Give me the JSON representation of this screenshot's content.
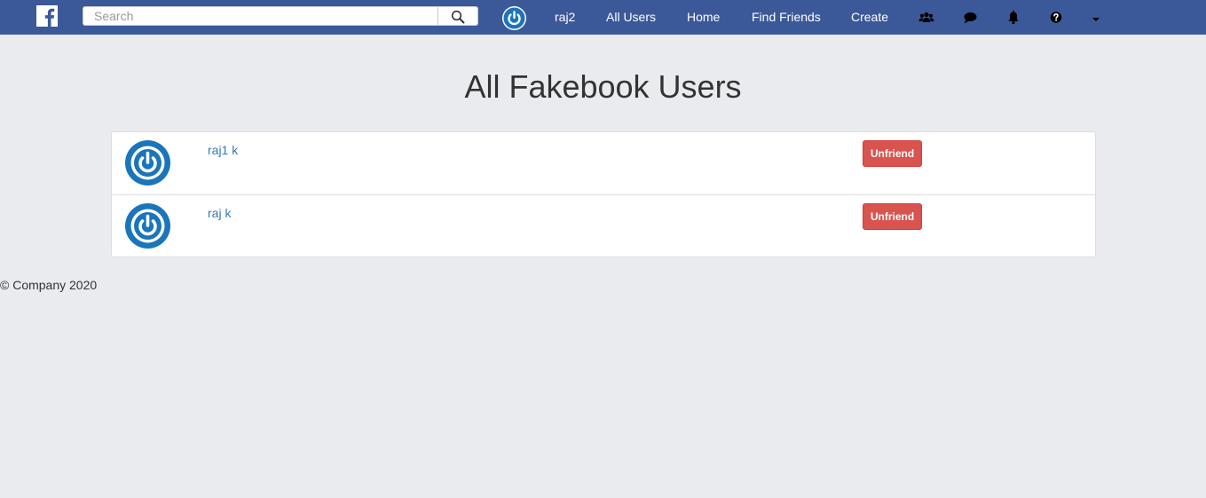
{
  "navbar": {
    "logo": "facebook-logo",
    "search": {
      "placeholder": "Search",
      "value": "",
      "button_icon": "search-icon"
    },
    "current_user": "raj2",
    "links": [
      "All Users",
      "Home",
      "Find Friends",
      "Create"
    ],
    "icons": [
      "users-icon",
      "comment-icon",
      "bell-icon",
      "question-circle-icon",
      "caret-down-icon"
    ],
    "background_color": "#3b5998"
  },
  "main": {
    "title": "All Fakebook Users",
    "users": [
      {
        "name": "raj1 k",
        "action_label": "Unfriend",
        "avatar_icon": "power-icon"
      },
      {
        "name": "raj k",
        "action_label": "Unfriend",
        "avatar_icon": "power-icon"
      }
    ]
  },
  "footer": {
    "text": "© Company 2020"
  },
  "colors": {
    "page_background": "#e9ebee",
    "link": "#337ab7",
    "danger": "#d9534f",
    "avatar_blue": "#1a75bb"
  }
}
